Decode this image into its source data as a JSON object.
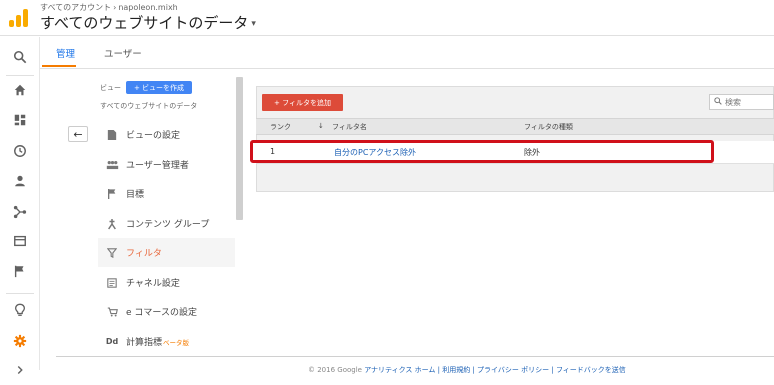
{
  "header": {
    "breadcrumb_account": "すべてのアカウント",
    "breadcrumb_sep": "›",
    "breadcrumb_property": "napoleon.mixh",
    "account_title": "すべてのウェブサイトのデータ",
    "caret": "▾"
  },
  "tabs": {
    "admin": "管理",
    "user": "ユーザー"
  },
  "view": {
    "label": "ビュー",
    "create_button": "+ ビューを作成",
    "name": "すべてのウェブサイトのデータ"
  },
  "menu": [
    {
      "label": "ビューの設定",
      "icon": "doc-icon"
    },
    {
      "label": "ユーザー管理者",
      "icon": "users-icon"
    },
    {
      "label": "目標",
      "icon": "flag-icon"
    },
    {
      "label": "コンテンツ グループ",
      "icon": "content-group-icon"
    },
    {
      "label": "フィルタ",
      "icon": "filter-icon",
      "active": true
    },
    {
      "label": "チャネル設定",
      "icon": "channel-icon"
    },
    {
      "label": "e コマースの設定",
      "icon": "cart-icon"
    },
    {
      "label": "計算指標",
      "icon": "dd-icon",
      "badge": "ベータ版"
    }
  ],
  "filters": {
    "add_button": "+ フィルタを追加",
    "search_placeholder": "検索",
    "columns": [
      "ランク",
      "フィルタ名",
      "フィルタの種類"
    ],
    "sort_indicator": "↓",
    "rows": [
      {
        "rank": "1",
        "name": "自分のPCアクセス除外",
        "type": "除外"
      }
    ]
  },
  "footer": {
    "text": "© 2016 Google",
    "links": "アナリティクス ホーム | 利用規約 | プライバシー ポリシー | フィードバックを送信"
  },
  "colors": {
    "accent_orange": "#f57c00",
    "add_red": "#dd4b39",
    "create_blue": "#4285f4",
    "highlight_red": "#d0101a"
  }
}
